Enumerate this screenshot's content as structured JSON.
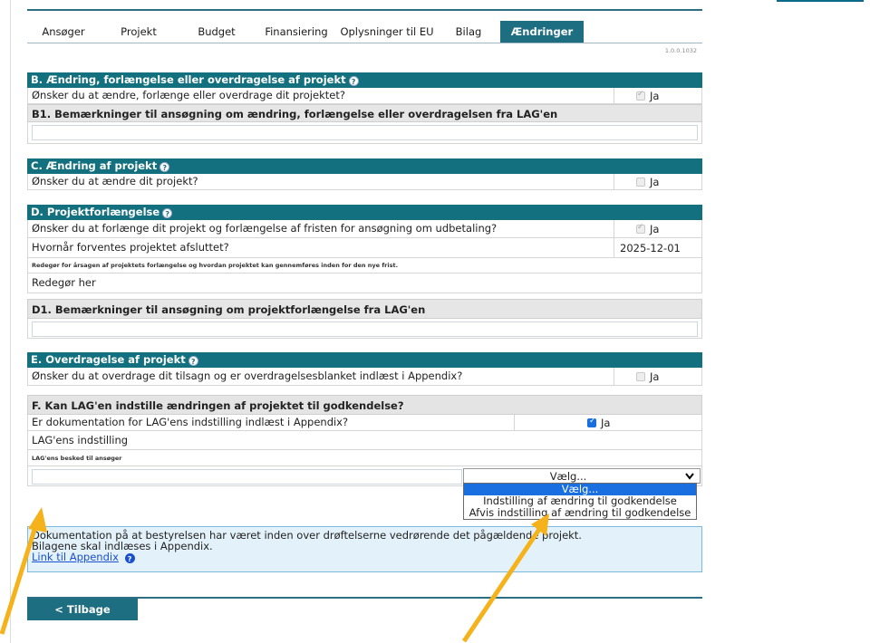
{
  "tabs": [
    {
      "label": "Ansøger"
    },
    {
      "label": "Projekt"
    },
    {
      "label": "Budget"
    },
    {
      "label": "Finansiering"
    },
    {
      "label": "Oplysninger til EU"
    },
    {
      "label": "Bilag"
    },
    {
      "label": "Ændringer"
    }
  ],
  "version": "1.0.0.1032",
  "yes_label": "Ja",
  "sectionB": {
    "title": "B. Ændring, forlængelse eller overdragelse af projekt",
    "question": "Ønsker du at ændre, forlænge eller overdrage dit projektet?",
    "sub_title": "B1. Bemærkninger til ansøgning om ændring, forlængelse eller overdragelsen fra LAG'en"
  },
  "sectionC": {
    "title": "C. Ændring af projekt",
    "question": "Ønsker du at ændre dit projekt?"
  },
  "sectionD": {
    "title": "D. Projektforlængelse",
    "question": "Ønsker du at forlænge dit projekt og forlængelse af fristen for ansøgning om udbetaling?",
    "end_question": "Hvornår forventes projektet afsluttet?",
    "end_date": "2025-12-01",
    "reason_label": "Redegør for årsagen af projektets forlængelse og hvordan projektet kan gennemføres inden for den nye frist.",
    "reason_value": "Redegør her",
    "sub_title": "D1. Bemærkninger til ansøgning om projektforlængelse fra LAG'en"
  },
  "sectionE": {
    "title": "E. Overdragelse af projekt",
    "question": "Ønsker du at overdrage dit tilsagn og er overdragelsesblanket indlæst i Appendix?"
  },
  "sectionF": {
    "title": "F. Kan LAG'en indstille ændringen af projektet til godkendelse?",
    "question": "Er dokumentation for LAG'ens indstilling indlæst i Appendix?",
    "recommendation_label": "LAG'ens indstilling",
    "select_value": "Vælg...",
    "options": [
      "Vælg...",
      "Indstilling af ændring til godkendelse",
      "Afvis indstilling af ændring til godkendelse"
    ],
    "message_label": "LAG'ens besked til ansøger",
    "info_line1": "Dokumentation på at bestyrelsen har været inden over drøftelserne vedrørende det pågældende projekt.",
    "info_line2": "Bilagene skal indlæses i Appendix.",
    "info_link": "Link til Appendix"
  },
  "back_button": "< Tilbage",
  "colors": {
    "header": "#12707f",
    "tab_active": "#1e6e82",
    "arrow": "#f6b21b",
    "select_highlight": "#1a6fe0"
  }
}
